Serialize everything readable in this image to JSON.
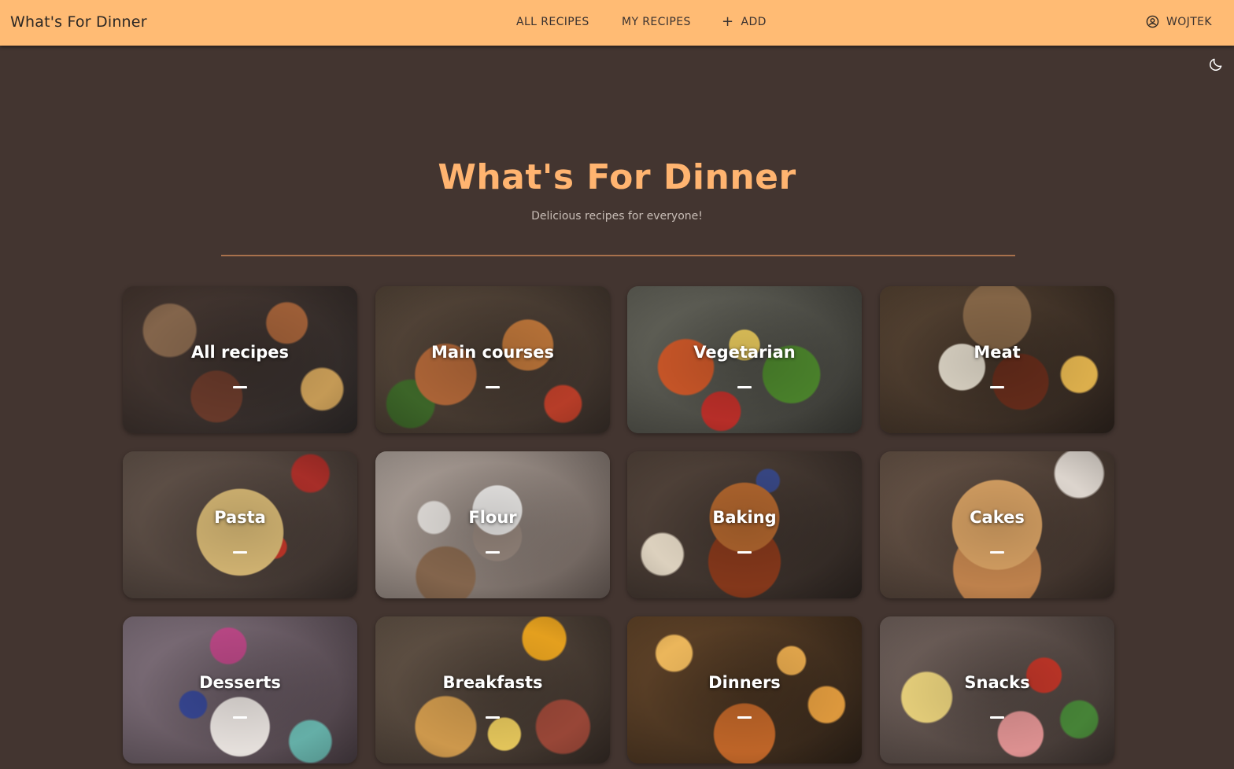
{
  "app": {
    "brand": "What's For Dinner"
  },
  "nav": {
    "all_recipes": "ALL RECIPES",
    "my_recipes": "MY RECIPES",
    "add": "ADD",
    "user": "WOJTEK"
  },
  "hero": {
    "title": "What's For Dinner",
    "subtitle": "Delicious recipes for everyone!"
  },
  "categories": [
    {
      "label": "All recipes"
    },
    {
      "label": "Main courses"
    },
    {
      "label": "Vegetarian"
    },
    {
      "label": "Meat"
    },
    {
      "label": "Pasta"
    },
    {
      "label": "Flour"
    },
    {
      "label": "Baking"
    },
    {
      "label": "Cakes"
    },
    {
      "label": "Desserts"
    },
    {
      "label": "Breakfasts"
    },
    {
      "label": "Dinners"
    },
    {
      "label": "Snacks"
    }
  ],
  "colors": {
    "navbar": "#ffbb74",
    "background": "#433530",
    "accent": "#ffb470",
    "divider": "#a8714c"
  },
  "icons": {
    "user": "account-circle-icon",
    "theme": "moon-icon",
    "add": "plus-icon"
  }
}
